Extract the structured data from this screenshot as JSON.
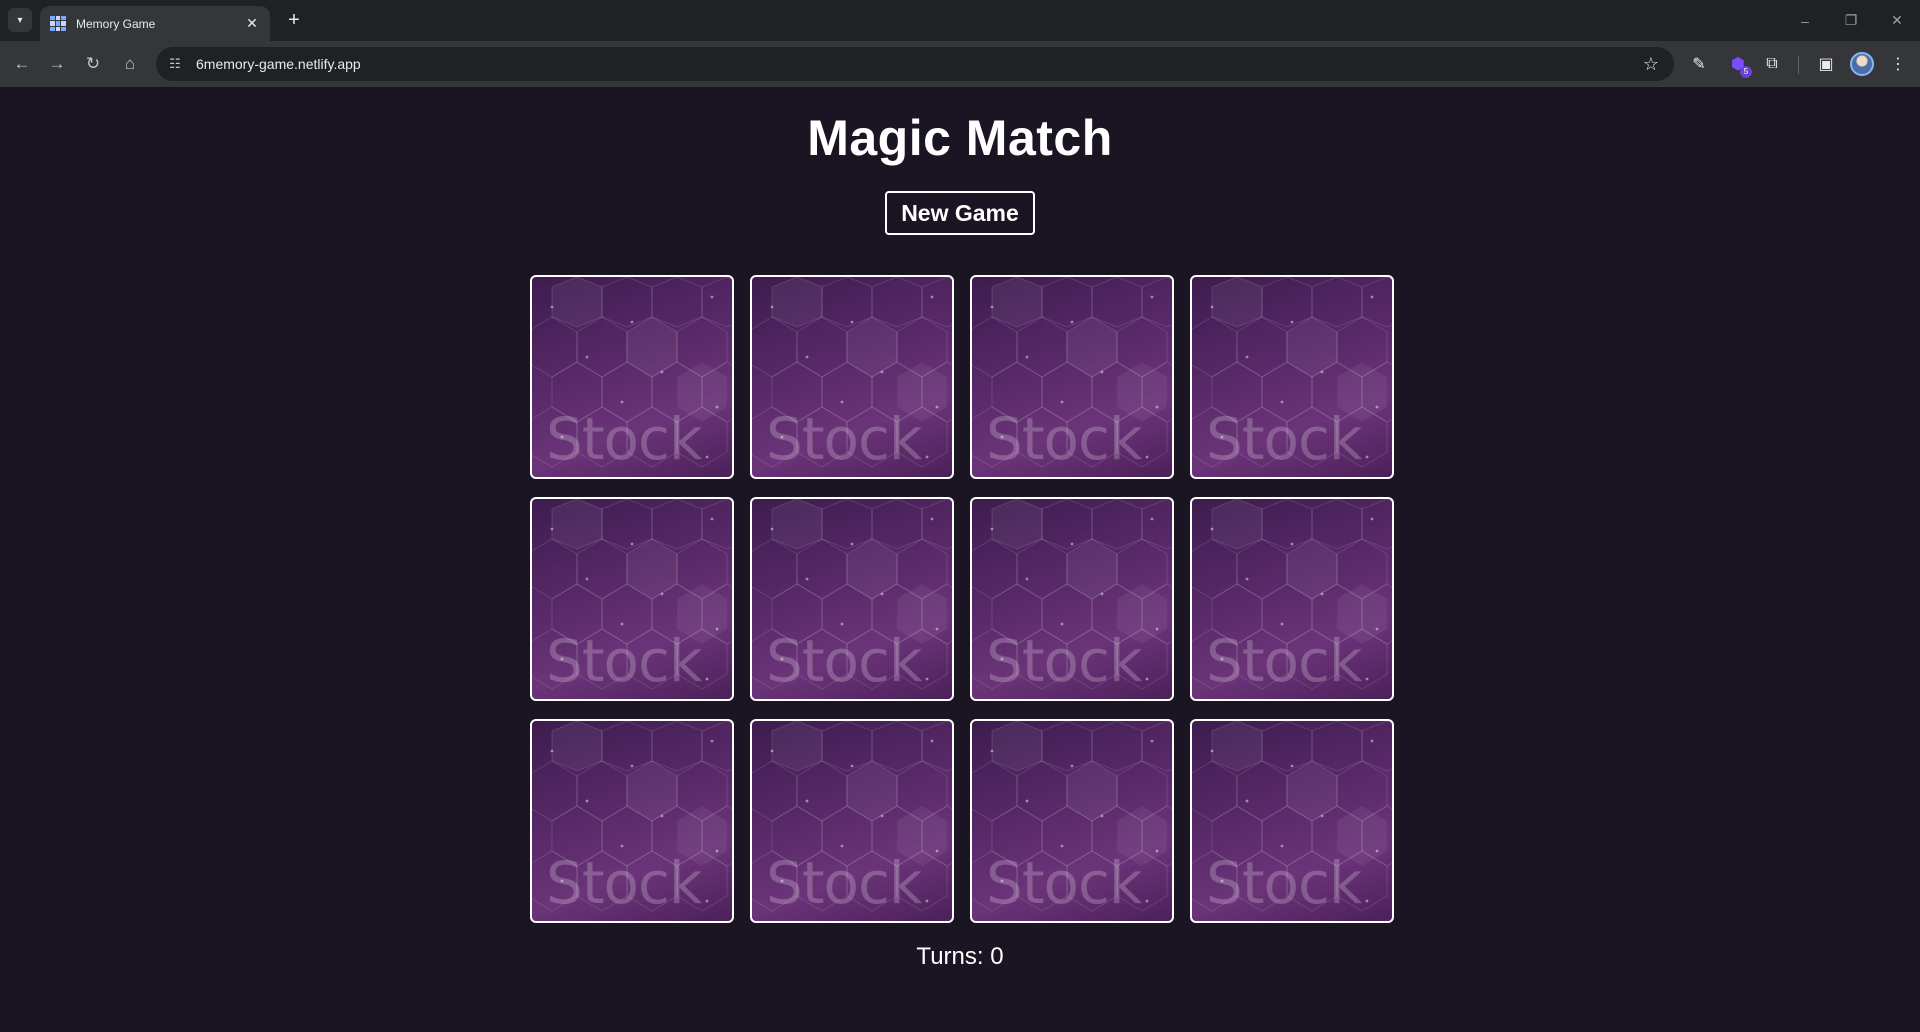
{
  "browser": {
    "tab_title": "Memory Game",
    "url": "6memory-game.netlify.app",
    "extension_badge": "5"
  },
  "game": {
    "title": "Magic Match",
    "new_game_label": "New Game",
    "card_back_watermark": "Stock",
    "card_count": 12,
    "turns_label": "Turns:",
    "turns_value": "0"
  }
}
